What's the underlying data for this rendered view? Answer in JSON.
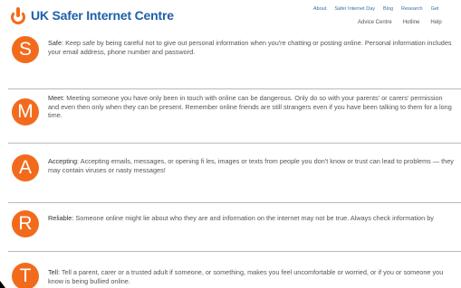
{
  "header": {
    "logo_text": "UK Safer Internet Centre",
    "top_links": [
      "About",
      "Safer Internet Day",
      "Blog",
      "Research",
      "Get"
    ],
    "main_links": [
      "Advice Centre",
      "Hotline",
      "Help"
    ]
  },
  "rules": [
    {
      "letter": "S",
      "title": "Safe",
      "text": ": Keep safe by being careful not to give out personal information when you're chatting or posting online. Personal information includes your email address, phone number and password."
    },
    {
      "letter": "M",
      "title": "Meet",
      "text": ": Meeting someone you have only been in touch with online can be dangerous. Only do so with your parents' or carers' permission and even then only when they can be present. Remember online friends are still strangers even if you have been talking to them for a long time."
    },
    {
      "letter": "A",
      "title": "Accepting",
      "text": ": Accepting emails, messages, or opening fi les, images or texts from people you don't know or trust can lead to problems — they may contain viruses or nasty messages!"
    },
    {
      "letter": "R",
      "title": "Reliable",
      "text": ": Someone online might lie about who they are and information on the internet may not be true. Always check information by"
    },
    {
      "letter": "T",
      "title": "Tell",
      "text": ": Tell a parent, carer or a trusted adult if someone, or something, makes you feel uncomfortable or worried, or if you or someone you know is being bullied online."
    }
  ],
  "colors": {
    "accent": "#f26b1d",
    "brand": "#1f5fa8"
  }
}
